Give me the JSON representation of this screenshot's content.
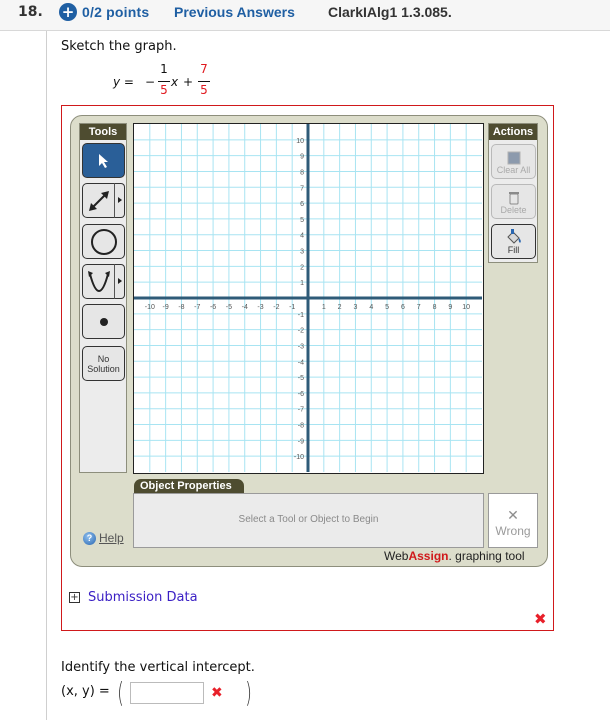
{
  "header": {
    "question_number": "18.",
    "points": "0/2 points",
    "previous_answers": "Previous Answers",
    "problem_code": "ClarkIAlg1 1.3.085."
  },
  "problem": {
    "prompt": "Sketch the graph.",
    "equation": {
      "lhs": "y =",
      "minus": "−",
      "coef_num": "1",
      "coef_den": "5",
      "var": "x",
      "plus": "+",
      "const_num": "7",
      "const_den": "5"
    }
  },
  "graph_tool": {
    "tools_title": "Tools",
    "tools": [
      {
        "name": "select",
        "label": "",
        "selected": true
      },
      {
        "name": "line",
        "label": "",
        "has_submenu": true
      },
      {
        "name": "circle",
        "label": ""
      },
      {
        "name": "parabola",
        "label": "",
        "has_submenu": true
      },
      {
        "name": "point",
        "label": ""
      },
      {
        "name": "no-solution",
        "label": "No Solution"
      }
    ],
    "no_solution_line1": "No",
    "no_solution_line2": "Solution",
    "actions_title": "Actions",
    "actions": [
      {
        "name": "clear-all",
        "label": "Clear All",
        "enabled": false
      },
      {
        "name": "delete",
        "label": "Delete",
        "enabled": false
      },
      {
        "name": "fill",
        "label": "Fill",
        "enabled": true
      }
    ],
    "axes": {
      "x_min": -11,
      "x_max": 11,
      "y_min": -11,
      "y_max": 11,
      "x_labels": [
        -10,
        -9,
        -8,
        -7,
        -6,
        -5,
        -4,
        -3,
        -2,
        -1,
        1,
        2,
        3,
        4,
        5,
        6,
        7,
        8,
        9,
        10
      ],
      "y_labels": [
        10,
        9,
        8,
        7,
        6,
        5,
        4,
        3,
        2,
        1,
        -1,
        -2,
        -3,
        -4,
        -5,
        -6,
        -7,
        -8,
        -9,
        -10
      ]
    },
    "colors": {
      "grid_line": "#a8e4f2",
      "axis_line": "#2f5b78",
      "panel_bg": "#dcddcb",
      "header_bg": "#4e4c30",
      "selected_tool": "#2a5f98"
    },
    "object_properties_title": "Object Properties",
    "object_properties_hint": "Select a Tool or Object to Begin",
    "status_label": "Wrong",
    "help_label": "Help",
    "brand_web": "Web",
    "brand_assign": "Assign",
    "brand_suffix": ". graphing tool"
  },
  "submission_data_label": "Submission Data",
  "graph_status": "incorrect",
  "question2": {
    "prompt": "Identify the vertical intercept.",
    "label": "(x, y) =",
    "open_paren": "(",
    "close_paren": ")",
    "input_value": "",
    "status": "incorrect"
  }
}
